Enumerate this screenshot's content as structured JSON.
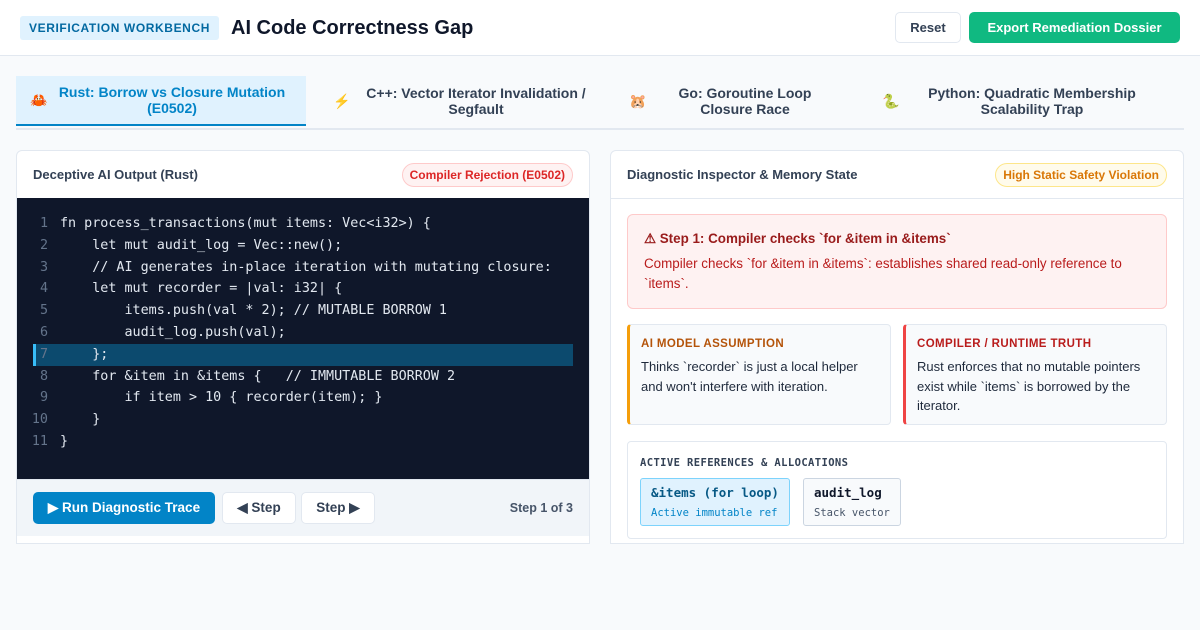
{
  "header": {
    "badge": "VERIFICATION WORKBENCH",
    "title": "AI Code Correctness Gap",
    "reset_label": "Reset",
    "export_label": "Export Remediation Dossier"
  },
  "tabs": [
    {
      "icon": "🦀",
      "icon_name": "crab-icon",
      "label": "Rust: Borrow vs Closure Mutation (E0502)",
      "active": true
    },
    {
      "icon": "⚡",
      "icon_name": "lightning-icon",
      "label": "C++: Vector Iterator Invalidation / Segfault",
      "active": false
    },
    {
      "icon": "🐹",
      "icon_name": "gopher-icon",
      "label": "Go: Goroutine Loop Closure Race",
      "active": false
    },
    {
      "icon": "🐍",
      "icon_name": "snake-icon",
      "label": "Python: Quadratic Membership Scalability Trap",
      "active": false
    }
  ],
  "left_panel": {
    "title": "Deceptive AI Output (Rust)",
    "badge": "Compiler Rejection (E0502)",
    "code_lines": [
      {
        "n": "1",
        "text": "fn process_transactions(mut items: Vec<i32>) {"
      },
      {
        "n": "2",
        "text": "    let mut audit_log = Vec::new();"
      },
      {
        "n": "3",
        "text": "    // AI generates in-place iteration with mutating closure:"
      },
      {
        "n": "4",
        "text": "    let mut recorder = |val: i32| {"
      },
      {
        "n": "5",
        "text": "        items.push(val * 2); // MUTABLE BORROW 1"
      },
      {
        "n": "6",
        "text": "        audit_log.push(val);"
      },
      {
        "n": "7",
        "text": "    };"
      },
      {
        "n": "8",
        "text": "    for &item in &items {   // IMMUTABLE BORROW 2"
      },
      {
        "n": "9",
        "text": "        if item > 10 { recorder(item); }"
      },
      {
        "n": "10",
        "text": "    }"
      },
      {
        "n": "11",
        "text": "}"
      }
    ],
    "highlighted_line": "7",
    "run_label": "▶ Run Diagnostic Trace",
    "prev_label": "◀ Step",
    "next_label": "Step ▶",
    "step_counter": "Step 1 of 3"
  },
  "right_panel": {
    "title": "Diagnostic Inspector & Memory State",
    "badge": "High Static Safety Violation",
    "alert_title": "⚠ Step 1: Compiler checks `for &item in &items`",
    "alert_body": "Compiler checks `for &item in &items`: establishes shared read-only reference to `items`.",
    "ai_label": "AI MODEL ASSUMPTION",
    "ai_text": "Thinks `recorder` is just a local helper and won't interfere with iteration.",
    "truth_label": "COMPILER / RUNTIME TRUTH",
    "truth_text": "Rust enforces that no mutable pointers exist while `items` is borrowed by the iterator.",
    "refs_title": "ACTIVE REFERENCES & ALLOCATIONS",
    "refs": [
      {
        "name": "&items (for loop)",
        "sub": "Active immutable ref"
      },
      {
        "name": "audit_log",
        "sub": "Stack vector"
      }
    ]
  },
  "colors": {
    "accent": "#0284c7",
    "export": "#10b981",
    "error": "#dc2626",
    "warning": "#d97706",
    "code_bg": "#0f172a"
  }
}
